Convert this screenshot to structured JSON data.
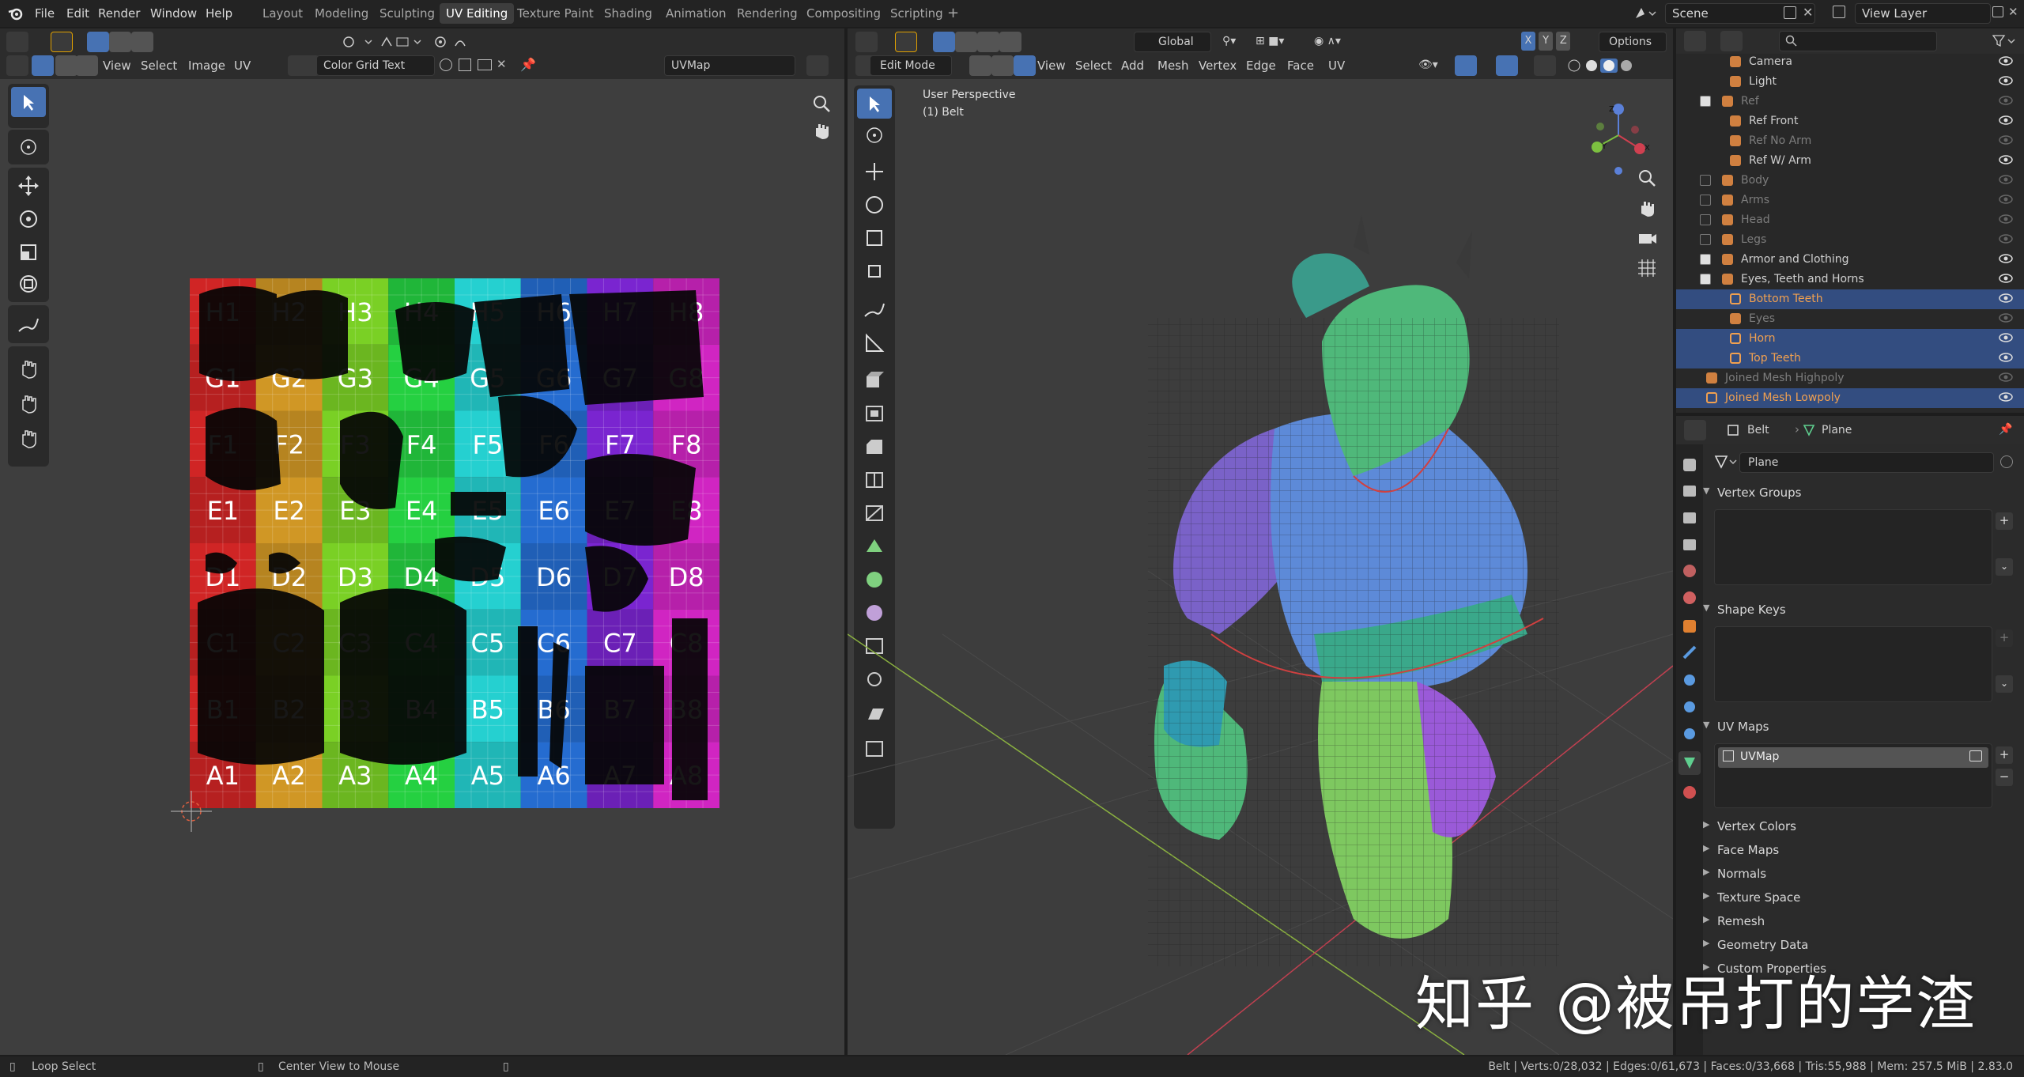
{
  "menubar": {
    "items": [
      "File",
      "Edit",
      "Render",
      "Window",
      "Help"
    ],
    "workspaces": [
      "Layout",
      "Modeling",
      "Sculpting",
      "UV Editing",
      "Texture Paint",
      "Shading",
      "Animation",
      "Rendering",
      "Compositing",
      "Scripting"
    ],
    "active_workspace": "UV Editing",
    "add_tab": "+",
    "scene": "Scene",
    "view_layer": "View Layer"
  },
  "uv_editor": {
    "menus": [
      "View",
      "Select",
      "Image",
      "UV"
    ],
    "image_name": "Color Grid Text",
    "uv_map": "UVMap",
    "grid_rows": [
      "H",
      "G",
      "F",
      "E",
      "D",
      "C",
      "B",
      "A"
    ],
    "grid_cols": [
      "1",
      "2",
      "3",
      "4",
      "5",
      "6",
      "7",
      "8"
    ],
    "grid_labels": [
      [
        "H1",
        "H2",
        "H3",
        "H4",
        "H5",
        "H6",
        "H7",
        "H8"
      ],
      [
        "G1",
        "G2",
        "G3",
        "G4",
        "G5",
        "G6",
        "G7",
        "G8"
      ],
      [
        "F1",
        "F2",
        "F3",
        "F4",
        "F5",
        "F6",
        "F7",
        "F8"
      ],
      [
        "E1",
        "E2",
        "E3",
        "E4",
        "E5",
        "E6",
        "E7",
        "E8"
      ],
      [
        "D1",
        "D2",
        "D3",
        "D4",
        "D5",
        "D6",
        "D7",
        "D8"
      ],
      [
        "C1",
        "C2",
        "C3",
        "C4",
        "C5",
        "C6",
        "C7",
        "C8"
      ],
      [
        "B1",
        "B2",
        "B3",
        "B4",
        "B5",
        "B6",
        "B7",
        "B8"
      ],
      [
        "A1",
        "A2",
        "A3",
        "A4",
        "A5",
        "A6",
        "A7",
        "A8"
      ]
    ]
  },
  "viewport": {
    "mode": "Edit Mode",
    "menus": [
      "View",
      "Select",
      "Add",
      "Mesh",
      "Vertex",
      "Edge",
      "Face",
      "UV"
    ],
    "orientation": "Global",
    "options_label": "Options",
    "axis_toggles": [
      "X",
      "Y",
      "Z"
    ],
    "info_line1": "User Perspective",
    "info_line2": "(1) Belt",
    "gizmo_labels": [
      "Z",
      "Y",
      "X"
    ]
  },
  "outliner": {
    "search_placeholder": "",
    "rows": [
      {
        "label": "Camera",
        "style": "normal",
        "selected": false
      },
      {
        "label": "Light",
        "style": "normal",
        "selected": false
      },
      {
        "label": "Ref",
        "style": "dim",
        "selected": false
      },
      {
        "label": "Ref Front",
        "style": "normal",
        "selected": false
      },
      {
        "label": "Ref No Arm",
        "style": "dim",
        "selected": false
      },
      {
        "label": "Ref W/ Arm",
        "style": "normal",
        "selected": false
      },
      {
        "label": "Body",
        "style": "dim",
        "selected": false
      },
      {
        "label": "Arms",
        "style": "dim",
        "selected": false
      },
      {
        "label": "Head",
        "style": "dim",
        "selected": false
      },
      {
        "label": "Legs",
        "style": "dim",
        "selected": false
      },
      {
        "label": "Armor and Clothing",
        "style": "normal",
        "selected": false
      },
      {
        "label": "Eyes, Teeth and Horns",
        "style": "normal",
        "selected": false
      },
      {
        "label": "Bottom Teeth",
        "style": "orange",
        "selected": true
      },
      {
        "label": "Eyes",
        "style": "dim",
        "selected": false
      },
      {
        "label": "Horn",
        "style": "orange",
        "selected": true
      },
      {
        "label": "Top Teeth",
        "style": "orange",
        "selected": true
      },
      {
        "label": "Joined Mesh Highpoly",
        "style": "dim",
        "selected": false
      },
      {
        "label": "Joined Mesh Lowpoly",
        "style": "orange",
        "selected": true
      }
    ]
  },
  "properties": {
    "breadcrumb_object": "Belt",
    "breadcrumb_data": "Plane",
    "data_name": "Plane",
    "sections": {
      "vertex_groups": "Vertex Groups",
      "shape_keys": "Shape Keys",
      "uv_maps": "UV Maps",
      "uv_map_item": "UVMap",
      "vertex_colors": "Vertex Colors",
      "face_maps": "Face Maps",
      "normals": "Normals",
      "texture_space": "Texture Space",
      "remesh": "Remesh",
      "geometry_data": "Geometry Data",
      "custom_properties": "Custom Properties"
    }
  },
  "statusbar": {
    "left_action": "Loop Select",
    "mid_action": "Center View to Mouse",
    "stats": "Belt | Verts:0/28,032 | Edges:0/61,673 | Faces:0/33,668 | Tris:55,988 | Mem: 257.5 MiB | 2.83.0"
  },
  "watermark": "知乎 @被吊打的学渣",
  "colors": {
    "accent": "#4772b3",
    "selection_row": "#334d80",
    "orange_text": "#f0a050",
    "viewport_bg": "#3d3d3d"
  }
}
